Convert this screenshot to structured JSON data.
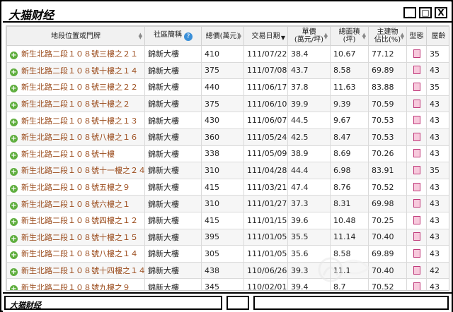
{
  "window": {
    "title": "大猫财经",
    "min_label": "_",
    "max_label": "□",
    "close_label": "X"
  },
  "status": {
    "title": "大猫财经"
  },
  "table": {
    "headers": {
      "address": "地段位置或門牌",
      "community": "社區簡稱",
      "total_price": "總價(萬元)",
      "date": "交易日期",
      "unit_price": "單價\n(萬元/坪)",
      "area": "總面積\n(坪)",
      "main_ratio": "主建物\n佔比(%)",
      "type": "型態",
      "age": "屋齡"
    },
    "rows": [
      {
        "address": "新生北路二段１０８號三樓之２１",
        "community": "錦新大樓",
        "total_price": "410",
        "date": "111/07/22",
        "unit_price": "38.4",
        "area": "10.67",
        "main_ratio": "77.12",
        "age": "35"
      },
      {
        "address": "新生北路二段１０８號十樓之１４",
        "community": "錦新大樓",
        "total_price": "375",
        "date": "111/07/08",
        "unit_price": "43.7",
        "area": "8.58",
        "main_ratio": "69.89",
        "age": "43"
      },
      {
        "address": "新生北路二段１０８號三樓之２２",
        "community": "錦新大樓",
        "total_price": "440",
        "date": "111/06/17",
        "unit_price": "37.8",
        "area": "11.63",
        "main_ratio": "83.88",
        "age": "35"
      },
      {
        "address": "新生北路二段１０８號十樓之２",
        "community": "錦新大樓",
        "total_price": "375",
        "date": "111/06/10",
        "unit_price": "39.9",
        "area": "9.39",
        "main_ratio": "70.59",
        "age": "43"
      },
      {
        "address": "新生北路二段１０８號十樓之１３",
        "community": "錦新大樓",
        "total_price": "430",
        "date": "111/06/07",
        "unit_price": "44.5",
        "area": "9.67",
        "main_ratio": "70.53",
        "age": "43"
      },
      {
        "address": "新生北路二段１０８號八樓之１６",
        "community": "錦新大樓",
        "total_price": "360",
        "date": "111/05/24",
        "unit_price": "42.5",
        "area": "8.47",
        "main_ratio": "70.53",
        "age": "43"
      },
      {
        "address": "新生北路二段１０８號十樓",
        "community": "錦新大樓",
        "total_price": "338",
        "date": "111/05/09",
        "unit_price": "38.9",
        "area": "8.69",
        "main_ratio": "70.26",
        "age": "43"
      },
      {
        "address": "新生北路二段１０８號十一樓之２４",
        "community": "錦新大樓",
        "total_price": "310",
        "date": "111/04/28",
        "unit_price": "44.4",
        "area": "6.98",
        "main_ratio": "83.91",
        "age": "35"
      },
      {
        "address": "新生北路二段１０８號五樓之９",
        "community": "錦新大樓",
        "total_price": "415",
        "date": "111/03/21",
        "unit_price": "47.4",
        "area": "8.76",
        "main_ratio": "70.52",
        "age": "43"
      },
      {
        "address": "新生北路二段１０８號六樓之１",
        "community": "錦新大樓",
        "total_price": "310",
        "date": "111/01/27",
        "unit_price": "37.3",
        "area": "8.31",
        "main_ratio": "69.98",
        "age": "43"
      },
      {
        "address": "新生北路二段１０８號四樓之１２",
        "community": "錦新大樓",
        "total_price": "415",
        "date": "111/01/15",
        "unit_price": "39.6",
        "area": "10.48",
        "main_ratio": "70.25",
        "age": "43"
      },
      {
        "address": "新生北路二段１０８號十樓之１５",
        "community": "錦新大樓",
        "total_price": "395",
        "date": "111/01/05",
        "unit_price": "35.5",
        "area": "11.14",
        "main_ratio": "70.40",
        "age": "43"
      },
      {
        "address": "新生北路二段１０８號八樓之１４",
        "community": "錦新大樓",
        "total_price": "305",
        "date": "111/01/05",
        "unit_price": "35.6",
        "area": "8.58",
        "main_ratio": "69.89",
        "age": "43"
      },
      {
        "address": "新生北路二段１０８號十四樓之１４",
        "community": "錦新大樓",
        "total_price": "438",
        "date": "110/06/26",
        "unit_price": "39.3",
        "area": "11.1",
        "main_ratio": "70.40",
        "age": "42"
      },
      {
        "address": "新生北路二段１０８號九樓之９",
        "community": "錦新大樓",
        "total_price": "345",
        "date": "110/02/01",
        "unit_price": "39.4",
        "area": "8.7",
        "main_ratio": "70.52",
        "age": "43"
      }
    ]
  }
}
